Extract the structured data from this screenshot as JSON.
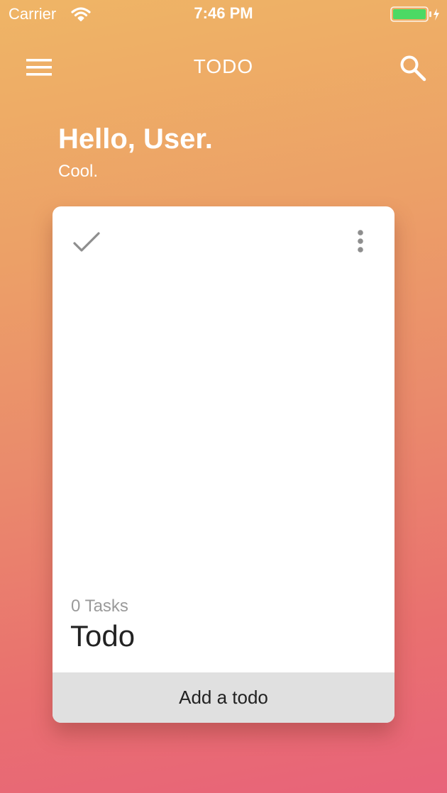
{
  "status_bar": {
    "carrier": "Carrier",
    "time": "7:46 PM",
    "battery_color": "#4cd964"
  },
  "app_bar": {
    "title": "TODO",
    "menu_icon": "hamburger-menu-icon",
    "search_icon": "search-icon"
  },
  "greeting": {
    "title": "Hello, User.",
    "subtitle": "Cool."
  },
  "card": {
    "check_icon": "checkmark-icon",
    "more_icon": "more-vertical-icon",
    "task_count": "0 Tasks",
    "title": "Todo",
    "add_label": "Add a todo"
  }
}
